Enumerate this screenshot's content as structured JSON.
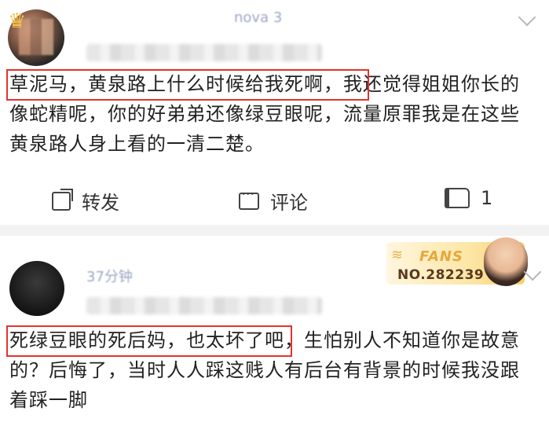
{
  "post1": {
    "device": "nova 3",
    "highlight_text": "草泥马，黄泉路上什么时候给我死啊，",
    "rest_text": "我还觉得姐姐你长的像蛇精呢，你的好弟弟还像绿豆眼呢，流量原罪我是在这些黄泉路人身上看的一清二楚。",
    "actions": {
      "repost": "转发",
      "comment": "评论",
      "likes": "1"
    }
  },
  "post2": {
    "time": "37分钟",
    "fans_badge": {
      "title": "FANS",
      "number": "NO.282239"
    },
    "highlight_text": "死绿豆眼的死后妈，也太坏了",
    "rest_text": "吧，生怕别人不知道你是故意的？后悔了，当时人人踩这贱人有后台有背景的时候我没跟着踩一脚"
  },
  "colors": {
    "highlight_border": "#e5322d",
    "fans_gold": "#e6a83a"
  }
}
